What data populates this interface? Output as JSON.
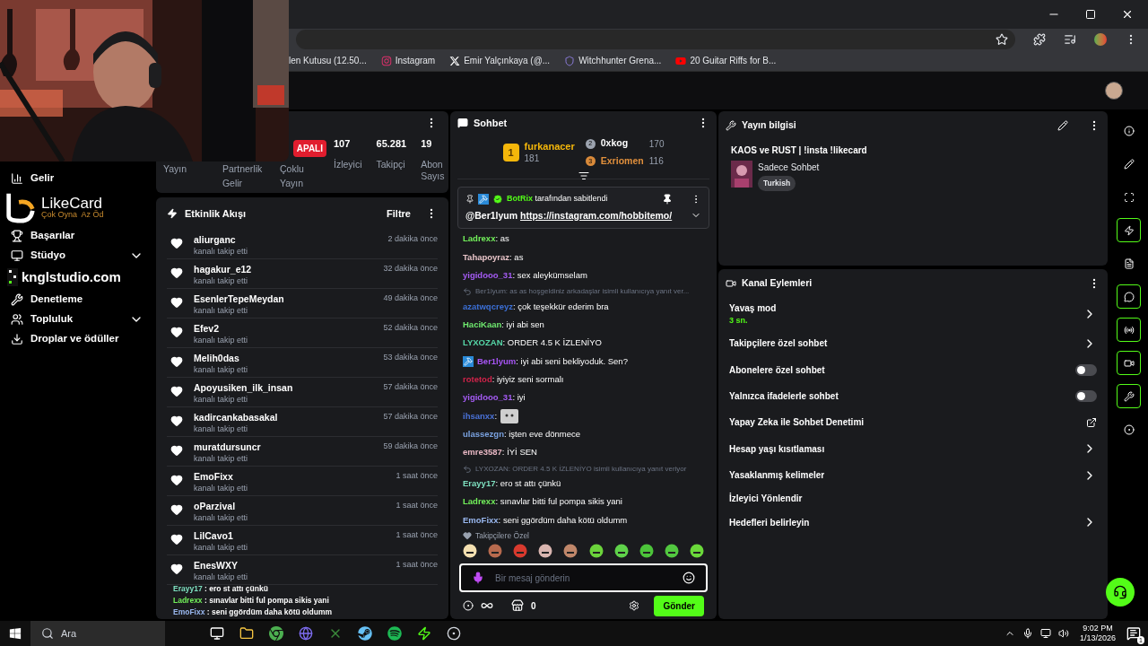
{
  "browser": {
    "bookmarks": [
      {
        "label": "len Kutusu (12.50...",
        "kind": "plain"
      },
      {
        "label": "Instagram",
        "kind": "instagram"
      },
      {
        "label": "Emir Yalçınkaya (@...",
        "kind": "x"
      },
      {
        "label": "Witchhunter Grena...",
        "kind": "shield"
      },
      {
        "label": "20 Guitar Riffs for B...",
        "kind": "youtube"
      }
    ]
  },
  "overlays": {
    "likecard": {
      "name": "LikeCard",
      "slogan": "Çok Oyna  Az Öd"
    },
    "studio": "knglstudio.com",
    "stream_chat": [
      {
        "user": "Erayy17",
        "color": "#7ee0c0",
        "text": " : ero st attı çünkü"
      },
      {
        "user": "Ladrexx",
        "color": "#72f05a",
        "text": " : sınavlar bitti ful pompa sikis yani"
      },
      {
        "user": "EmoFixx",
        "color": "#9ab8f0",
        "text": " : seni ggördüm daha kötü oldumm"
      }
    ]
  },
  "sidebar": {
    "items": [
      {
        "label": "Gelir",
        "kind": "link"
      },
      {
        "label": "Başarılar",
        "kind": "link"
      },
      {
        "label": "Stüdyo",
        "kind": "group",
        "expanded": false
      },
      {
        "label": "Denetleme",
        "kind": "link"
      },
      {
        "label": "Topluluk",
        "kind": "group",
        "expanded": false
      },
      {
        "label": "Droplar ve ödüller",
        "kind": "link"
      }
    ]
  },
  "stats_panel": {
    "status": "APALI",
    "tabs": [
      "Yayın",
      "Partnerlik Gelir",
      "Çoklu Yayın"
    ],
    "stats": [
      {
        "value": "107",
        "label": "İzleyici"
      },
      {
        "value": "65.281",
        "label": "Takipçi"
      },
      {
        "value": "19",
        "label": "Abon Sayıs"
      }
    ]
  },
  "activity": {
    "title": "Etkinlik Akışı",
    "filter": "Filtre",
    "events": [
      {
        "user": "aliurganc",
        "action": "kanalı takip etti",
        "time": "2 dakika önce"
      },
      {
        "user": "hagakur_e12",
        "action": "kanalı takip etti",
        "time": "32 dakika önce"
      },
      {
        "user": "EsenlerTepeMeydan",
        "action": "kanalı takip etti",
        "time": "49 dakika önce"
      },
      {
        "user": "Efev2",
        "action": "kanalı takip etti",
        "time": "52 dakika önce"
      },
      {
        "user": "Melih0das",
        "action": "kanalı takip etti",
        "time": "53 dakika önce"
      },
      {
        "user": "Apoyusiken_ilk_insan",
        "action": "kanalı takip etti",
        "time": "57 dakika önce"
      },
      {
        "user": "kadircankabasakal",
        "action": "kanalı takip etti",
        "time": "57 dakika önce"
      },
      {
        "user": "muratdursuncr",
        "action": "kanalı takip etti",
        "time": "59 dakika önce"
      },
      {
        "user": "EmoFixx",
        "action": "kanalı takip etti",
        "time": "1 saat önce"
      },
      {
        "user": "oParzival",
        "action": "kanalı takip etti",
        "time": "1 saat önce"
      },
      {
        "user": "LilCavo1",
        "action": "kanalı takip etti",
        "time": "1 saat önce"
      },
      {
        "user": "EnesWXY",
        "action": "kanalı takip etti",
        "time": "1 saat önce"
      }
    ]
  },
  "chat": {
    "title": "Sohbet",
    "leaderboard": [
      {
        "rank": "1",
        "user": "furkanacer",
        "count": "181"
      },
      {
        "rank": "2",
        "user": "0xkog",
        "count": "170"
      },
      {
        "rank": "3",
        "user": "Exriomen",
        "count": "116"
      }
    ],
    "pinned": {
      "by": "BotRix",
      "by_suffix": "tarafından sabitlendi",
      "mention": "@Ber1lyum",
      "link": "https://instagram.com/hobbitemo/"
    },
    "messages": [
      {
        "kind": "message",
        "user": "Ladrexx",
        "color": "#72f05a",
        "text": ": as"
      },
      {
        "kind": "message",
        "user": "Tahapoyraz",
        "color": "#e8c4c8",
        "text": ": as"
      },
      {
        "kind": "message",
        "user": "yigidooo_31",
        "color": "#a55bf5",
        "text": ": sex aleykümselam"
      },
      {
        "kind": "reply",
        "text": "Ber1lyum: as as hoşgeldiniz arkadaşlar isimli kullanıcıya yanıt ver..."
      },
      {
        "kind": "message",
        "user": "azatwqcreyz",
        "color": "#3b6fd6",
        "text": ": çok teşekkür ederim bra"
      },
      {
        "kind": "message",
        "user": "HaciKaan",
        "color": "#6ee86e",
        "text": ": iyi abi sen"
      },
      {
        "kind": "message",
        "user": "LYXOZAN",
        "color": "#56d8a8",
        "text": ": ORDER 4.5 K İZLENİYO"
      },
      {
        "kind": "moderator",
        "user": "Ber1lyum",
        "color": "#a855f7",
        "text": ": iyi abi seni bekliyoduk. Sen?"
      },
      {
        "kind": "message",
        "user": "rotetod",
        "color": "#d0234a",
        "text": ": iyiyiz seni sormalı"
      },
      {
        "kind": "message",
        "user": "yigidooo_31",
        "color": "#a55bf5",
        "text": ": iyi"
      },
      {
        "kind": "emote",
        "user": "ihsanxx",
        "color": "#4a72d8",
        "text": ":"
      },
      {
        "kind": "message",
        "user": "ulassezgn",
        "color": "#7aa2e0",
        "text": ": işten eve dönmece"
      },
      {
        "kind": "message",
        "user": "emre3587",
        "color": "#e9b8c4",
        "text": ": İYİ SEN"
      },
      {
        "kind": "reply",
        "text": "LYXOZAN: ORDER 4.5 K İZLENİYO isimli kullanıcıya yanıt veriyor"
      },
      {
        "kind": "message",
        "user": "Erayy17",
        "color": "#7ee0c0",
        "text": ": ero st attı çünkü"
      },
      {
        "kind": "message",
        "user": "Ladrexx",
        "color": "#72f05a",
        "text": ": sınavlar bitti ful pompa sikis yani"
      },
      {
        "kind": "message",
        "user": "EmoFixx",
        "color": "#9ab8f0",
        "text": ": seni ggördüm daha kötü oldumm"
      }
    ],
    "followers_only_label": "Takipçilere Özel",
    "input": {
      "placeholder": "Bir mesaj gönderin"
    },
    "points": "0",
    "send": "Gönder"
  },
  "stream_info": {
    "title": "Yayın bilgisi",
    "stream_title": "KAOS ve RUST | !insta !likecard",
    "category": "Sadece Sohbet",
    "tags": [
      "Turkish"
    ]
  },
  "channel_actions": {
    "title": "Kanal Eylemleri",
    "items": [
      {
        "label": "Yavaş mod",
        "sub": "3 sn.",
        "kind": "link"
      },
      {
        "label": "Takipçilere özel sohbet",
        "kind": "link"
      },
      {
        "label": "Abonelere özel sohbet",
        "kind": "toggle",
        "on": false
      },
      {
        "label": "Yalnızca ifadelerle sohbet",
        "kind": "toggle",
        "on": false
      },
      {
        "label": "Yapay Zeka ile Sohbet Denetimi",
        "kind": "external"
      },
      {
        "label": "Hesap yaşı kısıtlaması",
        "kind": "link"
      },
      {
        "label": "Yasaklanmış kelimeler",
        "kind": "link"
      },
      {
        "label": "İzleyici Yönlendir",
        "kind": "plain"
      },
      {
        "label": "Hedefleri belirleyin",
        "kind": "link"
      }
    ]
  },
  "taskbar": {
    "search": "Ara",
    "time": "9:02 PM",
    "date": "1/13/2026",
    "notifications": "1"
  }
}
